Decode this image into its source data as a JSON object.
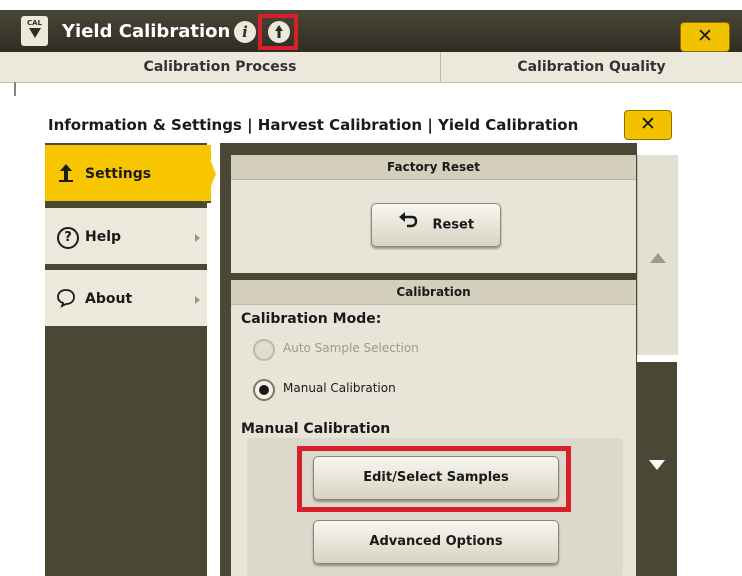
{
  "background_window": {
    "icon_text": "CAL",
    "title": "Yield Calibration",
    "info_icon_1": "i",
    "info_icon_2": "i",
    "close_label": "✕",
    "tabs": [
      {
        "label": "Calibration Process"
      },
      {
        "label": "Calibration Quality"
      }
    ]
  },
  "window": {
    "title": "Information & Settings | Harvest Calibration | Yield Calibration",
    "close_label": "✕"
  },
  "sidebar": {
    "items": [
      {
        "label": "Settings",
        "icon": "settings-icon",
        "selected": true
      },
      {
        "label": "Help",
        "icon": "help-icon"
      },
      {
        "label": "About",
        "icon": "about-icon"
      }
    ]
  },
  "factory_reset": {
    "header": "Factory Reset",
    "reset_button": "Reset"
  },
  "calibration": {
    "header": "Calibration",
    "mode_label": "Calibration Mode:",
    "options": [
      {
        "label": "Auto Sample Selection",
        "enabled": false,
        "checked": false
      },
      {
        "label": "Manual Calibration",
        "enabled": true,
        "checked": true
      }
    ],
    "manual_label": "Manual Calibration",
    "edit_button": "Edit/Select Samples",
    "advanced_button": "Advanced Options"
  },
  "colors": {
    "accent_yellow": "#f7c600",
    "highlight_red": "#d8202a",
    "dark_olive": "#4a4734"
  }
}
